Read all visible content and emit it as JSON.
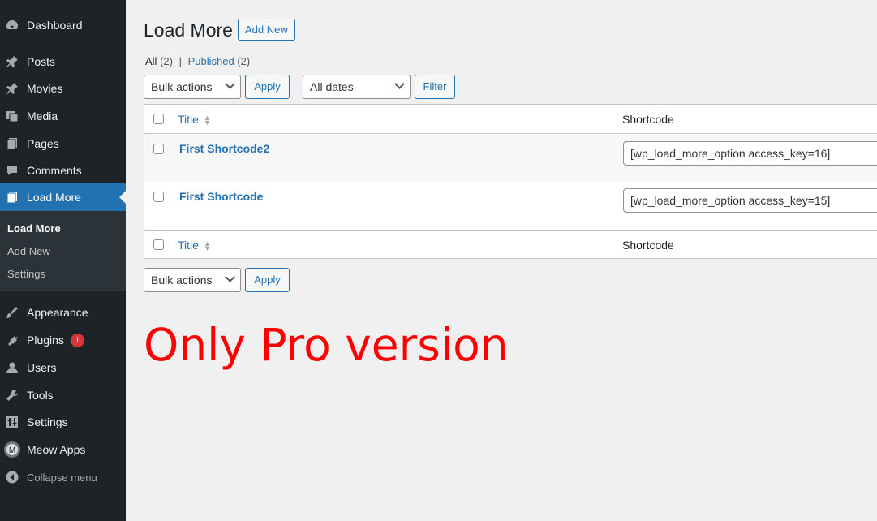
{
  "sidebar": {
    "items": [
      {
        "label": "Dashboard",
        "icon": "dashboard-icon"
      },
      {
        "label": "Posts",
        "icon": "pin-icon"
      },
      {
        "label": "Movies",
        "icon": "pin-icon"
      },
      {
        "label": "Media",
        "icon": "media-icon"
      },
      {
        "label": "Pages",
        "icon": "pages-icon"
      },
      {
        "label": "Comments",
        "icon": "comments-icon"
      },
      {
        "label": "Load More",
        "icon": "load-more-icon",
        "active": true
      },
      {
        "label": "Appearance",
        "icon": "appearance-icon"
      },
      {
        "label": "Plugins",
        "icon": "plugins-icon",
        "badge": "1"
      },
      {
        "label": "Users",
        "icon": "users-icon"
      },
      {
        "label": "Tools",
        "icon": "tools-icon"
      },
      {
        "label": "Settings",
        "icon": "settings-icon"
      },
      {
        "label": "Meow Apps",
        "icon": "meow-apps-icon"
      }
    ],
    "submenu": [
      "Load More",
      "Add New",
      "Settings"
    ],
    "collapse_label": "Collapse menu"
  },
  "header": {
    "title": "Load More",
    "add_new_label": "Add New"
  },
  "filters": {
    "all_label": "All",
    "all_count": "(2)",
    "separator": "|",
    "published_label": "Published",
    "published_count": "(2)"
  },
  "toolbar": {
    "bulk_actions": "Bulk actions",
    "apply_label": "Apply",
    "dates": "All dates",
    "filter_label": "Filter"
  },
  "table": {
    "columns": [
      "Title",
      "Shortcode"
    ],
    "rows": [
      {
        "title": "First Shortcode2",
        "shortcode": "[wp_load_more_option access_key=16]"
      },
      {
        "title": "First Shortcode",
        "shortcode": "[wp_load_more_option access_key=15]"
      }
    ]
  },
  "promo_text": "Only Pro version",
  "colors": {
    "sidebar_bg": "#1d2327",
    "accent": "#2271b1",
    "promo": "#ff0000",
    "badge": "#d63638"
  }
}
